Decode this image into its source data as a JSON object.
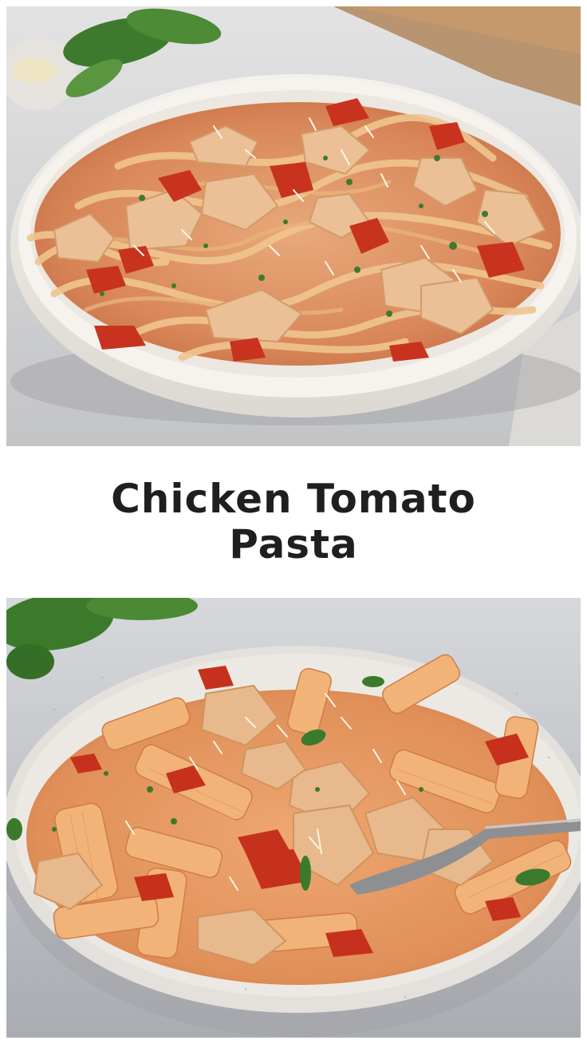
{
  "title": "Chicken Tomato Pasta",
  "images": [
    {
      "id": "top",
      "dish": "fettuccine-chicken-tomato"
    },
    {
      "id": "bottom",
      "dish": "penne-chicken-tomato"
    }
  ],
  "colors": {
    "background": "#ffffff",
    "title_text": "#1f1f1f",
    "countertop": "#c9cacc",
    "bowl": "#eeeae4",
    "sauce": "#e39a63",
    "tomato": "#c7321f",
    "chicken": "#e9b98c",
    "herb": "#3f7a2c"
  }
}
